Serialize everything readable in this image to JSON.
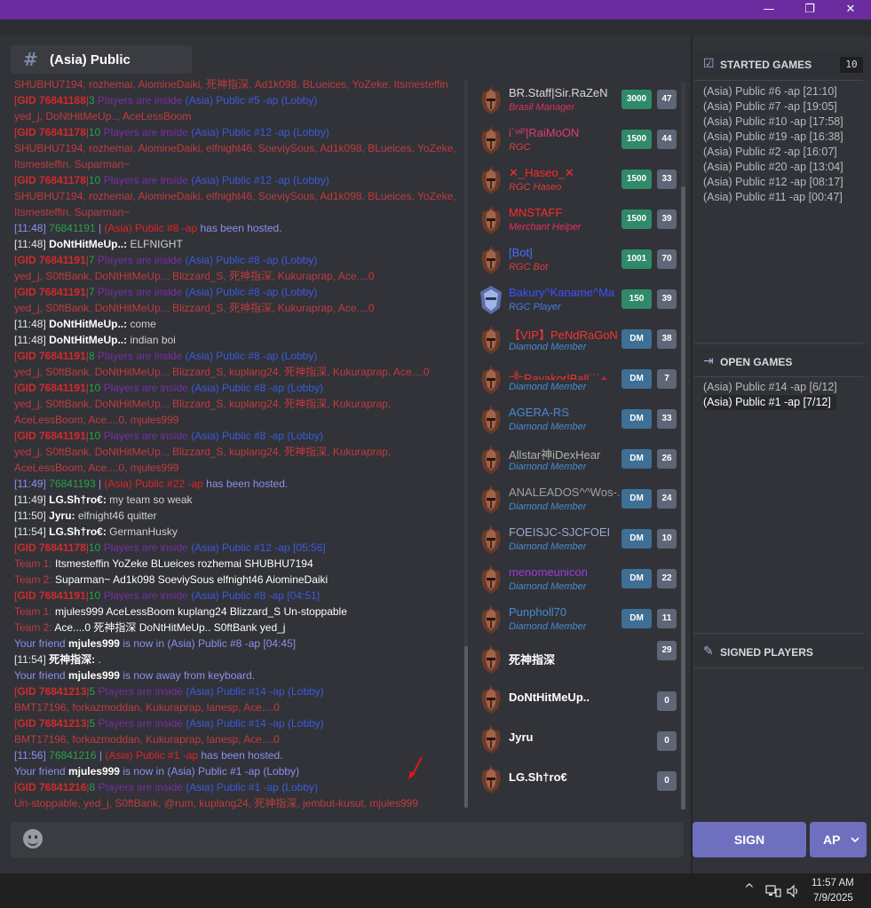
{
  "window": {
    "minimize_glyph": "—",
    "maximize_glyph": "❐",
    "close_glyph": "✕"
  },
  "channel": {
    "name": "(Asia) Public"
  },
  "chat": [
    {
      "parts": [
        {
          "t": "SHUBHU7194, rozhemai, AiomineDaiki, 死神指深, Ad1k098, BLueices, YoZeke, Itsmesteffin",
          "c": "#c23b3b"
        }
      ]
    },
    {
      "parts": [
        {
          "t": "[",
          "c": "#c23b3b"
        },
        {
          "t": "GID 76841188",
          "c": "#d22b2b",
          "b": true
        },
        {
          "t": "|",
          "c": "#c23b3b"
        },
        {
          "t": "3",
          "c": "#2aa14a"
        },
        {
          "t": " Players are inside ",
          "c": "#7a2ea3"
        },
        {
          "t": "(Asia) Public #5 -ap (Lobby)",
          "c": "#3b5bdb"
        }
      ]
    },
    {
      "parts": [
        {
          "t": "yed_j, DoNtHitMeUp.., AceLessBoom",
          "c": "#c23b3b"
        }
      ]
    },
    {
      "parts": [
        {
          "t": "[",
          "c": "#c23b3b"
        },
        {
          "t": "GID 76841178",
          "c": "#d22b2b",
          "b": true
        },
        {
          "t": "|",
          "c": "#c23b3b"
        },
        {
          "t": "10",
          "c": "#2aa14a"
        },
        {
          "t": " Players are inside ",
          "c": "#7a2ea3"
        },
        {
          "t": "(Asia) Public #12 -ap (Lobby)",
          "c": "#3b5bdb"
        }
      ]
    },
    {
      "parts": [
        {
          "t": "SHUBHU7194, rozhemai, AiomineDaiki, elfnight46, SoeviySous, Ad1k098, BLueices, YoZeke,",
          "c": "#c23b3b"
        }
      ]
    },
    {
      "parts": [
        {
          "t": "Itsmesteffin, Suparman~",
          "c": "#c23b3b"
        }
      ]
    },
    {
      "parts": [
        {
          "t": "[",
          "c": "#c23b3b"
        },
        {
          "t": "GID 76841178",
          "c": "#d22b2b",
          "b": true
        },
        {
          "t": "|",
          "c": "#c23b3b"
        },
        {
          "t": "10",
          "c": "#2aa14a"
        },
        {
          "t": " Players are inside ",
          "c": "#7a2ea3"
        },
        {
          "t": "(Asia) Public #12 -ap (Lobby)",
          "c": "#3b5bdb"
        }
      ]
    },
    {
      "parts": [
        {
          "t": "SHUBHU7194, rozhemai, AiomineDaiki, elfnight46, SoeviySous, Ad1k098, BLueices, YoZeke,",
          "c": "#c23b3b"
        }
      ]
    },
    {
      "parts": [
        {
          "t": "Itsmesteffin, Suparman~",
          "c": "#c23b3b"
        }
      ]
    },
    {
      "parts": [
        {
          "t": "[11:48] ",
          "c": "#8c8ff0"
        },
        {
          "t": "76841191",
          "c": "#2aa14a"
        },
        {
          "t": " | ",
          "c": "#8c8ff0"
        },
        {
          "t": "(Asia) Public #8 -ap",
          "c": "#e02424"
        },
        {
          "t": " has been hosted.",
          "c": "#8c8ff0"
        }
      ]
    },
    {
      "parts": [
        {
          "t": "[11:48] ",
          "c": "#e6e6e6"
        },
        {
          "t": "DoNtHitMeUp..: ",
          "c": "#ffffff",
          "b": true
        },
        {
          "t": "ELFNIGHT",
          "c": "#d0d0d0"
        }
      ]
    },
    {
      "parts": [
        {
          "t": "[",
          "c": "#c23b3b"
        },
        {
          "t": "GID 76841191",
          "c": "#d22b2b",
          "b": true
        },
        {
          "t": "|",
          "c": "#c23b3b"
        },
        {
          "t": "7",
          "c": "#2aa14a"
        },
        {
          "t": " Players are inside ",
          "c": "#7a2ea3"
        },
        {
          "t": "(Asia) Public #8 -ap (Lobby)",
          "c": "#3b5bdb"
        }
      ]
    },
    {
      "parts": [
        {
          "t": "yed_j, S0ftBank, DoNtHitMeUp.., Blizzard_S, 死神指深, Kukuraprap, Ace....0",
          "c": "#c23b3b"
        }
      ]
    },
    {
      "parts": [
        {
          "t": "[",
          "c": "#c23b3b"
        },
        {
          "t": "GID 76841191",
          "c": "#d22b2b",
          "b": true
        },
        {
          "t": "|",
          "c": "#c23b3b"
        },
        {
          "t": "7",
          "c": "#2aa14a"
        },
        {
          "t": " Players are inside ",
          "c": "#7a2ea3"
        },
        {
          "t": "(Asia) Public #8 -ap (Lobby)",
          "c": "#3b5bdb"
        }
      ]
    },
    {
      "parts": [
        {
          "t": "yed_j, S0ftBank, DoNtHitMeUp.., Blizzard_S, 死神指深, Kukuraprap, Ace....0",
          "c": "#c23b3b"
        }
      ]
    },
    {
      "parts": [
        {
          "t": "[11:48] ",
          "c": "#e6e6e6"
        },
        {
          "t": "DoNtHitMeUp..: ",
          "c": "#ffffff",
          "b": true
        },
        {
          "t": "come",
          "c": "#d0d0d0"
        }
      ]
    },
    {
      "parts": [
        {
          "t": "[11:48] ",
          "c": "#e6e6e6"
        },
        {
          "t": "DoNtHitMeUp..: ",
          "c": "#ffffff",
          "b": true
        },
        {
          "t": "indian boi",
          "c": "#d0d0d0"
        }
      ]
    },
    {
      "parts": [
        {
          "t": "[",
          "c": "#c23b3b"
        },
        {
          "t": "GID 76841191",
          "c": "#d22b2b",
          "b": true
        },
        {
          "t": "|",
          "c": "#c23b3b"
        },
        {
          "t": "8",
          "c": "#2aa14a"
        },
        {
          "t": " Players are inside ",
          "c": "#7a2ea3"
        },
        {
          "t": "(Asia) Public #8 -ap (Lobby)",
          "c": "#3b5bdb"
        }
      ]
    },
    {
      "parts": [
        {
          "t": "yed_j, S0ftBank, DoNtHitMeUp.., Blizzard_S, kuplang24, 死神指深, Kukuraprap, Ace....0",
          "c": "#c23b3b"
        }
      ]
    },
    {
      "parts": [
        {
          "t": "[",
          "c": "#c23b3b"
        },
        {
          "t": "GID 76841191",
          "c": "#d22b2b",
          "b": true
        },
        {
          "t": "|",
          "c": "#c23b3b"
        },
        {
          "t": "10",
          "c": "#2aa14a"
        },
        {
          "t": " Players are inside ",
          "c": "#7a2ea3"
        },
        {
          "t": "(Asia) Public #8 -ap (Lobby)",
          "c": "#3b5bdb"
        }
      ]
    },
    {
      "parts": [
        {
          "t": "yed_j, S0ftBank, DoNtHitMeUp.., Blizzard_S, kuplang24, 死神指深, Kukuraprap,",
          "c": "#c23b3b"
        }
      ]
    },
    {
      "parts": [
        {
          "t": "AceLessBoom, Ace....0, mjules999",
          "c": "#c23b3b"
        }
      ]
    },
    {
      "parts": [
        {
          "t": "[",
          "c": "#c23b3b"
        },
        {
          "t": "GID 76841191",
          "c": "#d22b2b",
          "b": true
        },
        {
          "t": "|",
          "c": "#c23b3b"
        },
        {
          "t": "10",
          "c": "#2aa14a"
        },
        {
          "t": " Players are inside ",
          "c": "#7a2ea3"
        },
        {
          "t": "(Asia) Public #8 -ap (Lobby)",
          "c": "#3b5bdb"
        }
      ]
    },
    {
      "parts": [
        {
          "t": "yed_j, S0ftBank, DoNtHitMeUp.., Blizzard_S, kuplang24, 死神指深, Kukuraprap,",
          "c": "#c23b3b"
        }
      ]
    },
    {
      "parts": [
        {
          "t": "AceLessBoom, Ace....0, mjules999",
          "c": "#c23b3b"
        }
      ]
    },
    {
      "parts": [
        {
          "t": "[11:49] ",
          "c": "#8c8ff0"
        },
        {
          "t": "76841193",
          "c": "#2aa14a"
        },
        {
          "t": " | ",
          "c": "#8c8ff0"
        },
        {
          "t": "(Asia) Public #22 -ap",
          "c": "#e02424"
        },
        {
          "t": " has been hosted.",
          "c": "#8c8ff0"
        }
      ]
    },
    {
      "parts": [
        {
          "t": "[11:49] ",
          "c": "#e6e6e6"
        },
        {
          "t": "LG.Sh†ro€: ",
          "c": "#ffffff",
          "b": true
        },
        {
          "t": "my team so weak",
          "c": "#d0d0d0"
        }
      ]
    },
    {
      "parts": [
        {
          "t": "[11:50] ",
          "c": "#e6e6e6"
        },
        {
          "t": "Jyru: ",
          "c": "#ffffff",
          "b": true
        },
        {
          "t": "elfnight46 quitter",
          "c": "#d0d0d0"
        }
      ]
    },
    {
      "parts": [
        {
          "t": "[11:54] ",
          "c": "#e6e6e6"
        },
        {
          "t": "LG.Sh†ro€: ",
          "c": "#ffffff",
          "b": true
        },
        {
          "t": "GermanHusky",
          "c": "#d0d0d0"
        }
      ]
    },
    {
      "parts": [
        {
          "t": "[",
          "c": "#c23b3b"
        },
        {
          "t": "GID 76841178",
          "c": "#d22b2b",
          "b": true
        },
        {
          "t": "|",
          "c": "#c23b3b"
        },
        {
          "t": "10",
          "c": "#2aa14a"
        },
        {
          "t": " Players are inside ",
          "c": "#7a2ea3"
        },
        {
          "t": "(Asia) Public #12 -ap [05:56]",
          "c": "#3b5bdb"
        }
      ]
    },
    {
      "parts": [
        {
          "t": "Team 1:   ",
          "c": "#c23b3b"
        },
        {
          "t": "Itsmesteffin    YoZeke    BLueices    rozhemai    SHUBHU7194",
          "c": "#ffffff"
        }
      ]
    },
    {
      "parts": [
        {
          "t": "Team 2:   ",
          "c": "#c23b3b"
        },
        {
          "t": "Suparman~    Ad1k098    SoeviySous    elfnight46    AiomineDaiki",
          "c": "#ffffff"
        }
      ]
    },
    {
      "parts": [
        {
          "t": "[",
          "c": "#c23b3b"
        },
        {
          "t": "GID 76841191",
          "c": "#d22b2b",
          "b": true
        },
        {
          "t": "|",
          "c": "#c23b3b"
        },
        {
          "t": "10",
          "c": "#2aa14a"
        },
        {
          "t": " Players are inside ",
          "c": "#7a2ea3"
        },
        {
          "t": "(Asia) Public #8 -ap [04:51]",
          "c": "#3b5bdb"
        }
      ]
    },
    {
      "parts": [
        {
          "t": "Team 1:   ",
          "c": "#c23b3b"
        },
        {
          "t": "mjules999    AceLessBoom    kuplang24    Blizzard_S    Un-stoppable",
          "c": "#ffffff"
        }
      ]
    },
    {
      "parts": [
        {
          "t": "Team 2:   ",
          "c": "#c23b3b"
        },
        {
          "t": "Ace....0    死神指深    DoNtHitMeUp..    S0ftBank    yed_j",
          "c": "#ffffff"
        }
      ]
    },
    {
      "parts": [
        {
          "t": "Your friend ",
          "c": "#8c8ff0"
        },
        {
          "t": "mjules999",
          "c": "#ffffff",
          "b": true
        },
        {
          "t": " is now in (Asia) Public #8 -ap [04:45]",
          "c": "#8c8ff0"
        }
      ]
    },
    {
      "parts": [
        {
          "t": "[11:54] ",
          "c": "#e6e6e6"
        },
        {
          "t": "死神指深: ",
          "c": "#ffffff",
          "b": true
        },
        {
          "t": ".",
          "c": "#d0d0d0"
        }
      ]
    },
    {
      "parts": [
        {
          "t": "Your friend ",
          "c": "#8c8ff0"
        },
        {
          "t": "mjules999",
          "c": "#ffffff",
          "b": true
        },
        {
          "t": " is now away from keyboard.",
          "c": "#8c8ff0"
        }
      ]
    },
    {
      "parts": [
        {
          "t": "[",
          "c": "#c23b3b"
        },
        {
          "t": "GID 76841213",
          "c": "#d22b2b",
          "b": true
        },
        {
          "t": "|",
          "c": "#c23b3b"
        },
        {
          "t": "5",
          "c": "#2aa14a"
        },
        {
          "t": " Players are inside ",
          "c": "#7a2ea3"
        },
        {
          "t": "(Asia) Public #14 -ap (Lobby)",
          "c": "#3b5bdb"
        }
      ]
    },
    {
      "parts": [
        {
          "t": "BMT17196, forkazmoddan, Kukuraprap, lanesp, Ace....0",
          "c": "#c23b3b"
        }
      ]
    },
    {
      "parts": [
        {
          "t": "[",
          "c": "#c23b3b"
        },
        {
          "t": "GID 76841213",
          "c": "#d22b2b",
          "b": true
        },
        {
          "t": "|",
          "c": "#c23b3b"
        },
        {
          "t": "5",
          "c": "#2aa14a"
        },
        {
          "t": " Players are inside ",
          "c": "#7a2ea3"
        },
        {
          "t": "(Asia) Public #14 -ap (Lobby)",
          "c": "#3b5bdb"
        }
      ]
    },
    {
      "parts": [
        {
          "t": "BMT17196, forkazmoddan, Kukuraprap, lanesp, Ace....0",
          "c": "#c23b3b"
        }
      ]
    },
    {
      "parts": [
        {
          "t": "[11:56] ",
          "c": "#8c8ff0"
        },
        {
          "t": "76841216",
          "c": "#2aa14a"
        },
        {
          "t": " | ",
          "c": "#8c8ff0"
        },
        {
          "t": "(Asia) Public #1 -ap",
          "c": "#e02424"
        },
        {
          "t": " has been hosted.",
          "c": "#8c8ff0"
        }
      ]
    },
    {
      "parts": [
        {
          "t": "Your friend ",
          "c": "#8c8ff0"
        },
        {
          "t": "mjules999",
          "c": "#ffffff",
          "b": true
        },
        {
          "t": " is now in (Asia) Public #1 -ap (Lobby)",
          "c": "#8c8ff0"
        }
      ]
    },
    {
      "parts": [
        {
          "t": "[",
          "c": "#c23b3b"
        },
        {
          "t": "GID 76841216",
          "c": "#d22b2b",
          "b": true
        },
        {
          "t": "|",
          "c": "#c23b3b"
        },
        {
          "t": "8",
          "c": "#2aa14a"
        },
        {
          "t": " Players are inside ",
          "c": "#7a2ea3"
        },
        {
          "t": "(Asia) Public #1 -ap (Lobby)",
          "c": "#3b5bdb"
        }
      ]
    },
    {
      "parts": [
        {
          "t": "Un-stoppable, yed_j, S0ftBank, @rum, kuplang24, 死神指深, jembut-kusut, mjules999",
          "c": "#c23b3b"
        }
      ]
    }
  ],
  "players": [
    {
      "name": "BR.Staff|Sir.RaZeN",
      "name_color": "#d8d8d8",
      "role": "Brasil Manager",
      "role_color": "#e0305a",
      "rank": "3000",
      "rank_color": "#2f8a6a",
      "count": "47",
      "avatar": "warrior"
    },
    {
      "name": "i´ᵛᶦᴾ|RaiMoON",
      "name_color": "#e03b6a",
      "role": "RGC",
      "role_color": "#e03b3b",
      "rank": "1500",
      "rank_color": "#2f8a6a",
      "count": "44",
      "avatar": "warrior"
    },
    {
      "name": "✕_Haseo_✕",
      "name_color": "#ff2a2a",
      "role": "RGC Haseo",
      "role_color": "#e03b3b",
      "rank": "1500",
      "rank_color": "#2f8a6a",
      "count": "33",
      "avatar": "warrior"
    },
    {
      "name": "MNSTAFF",
      "name_color": "#ff2a2a",
      "role": "Merchant Helper",
      "role_color": "#e0305a",
      "rank": "1500",
      "rank_color": "#2f8a6a",
      "count": "39",
      "avatar": "warrior"
    },
    {
      "name": "[Bot]",
      "name_color": "#4a6cff",
      "role": "RGC Bot",
      "role_color": "#e03b3b",
      "rank": "1001",
      "rank_color": "#2f8a6a",
      "count": "70",
      "avatar": "warrior"
    },
    {
      "name": "Bakury^Kaname^Ma",
      "name_color": "#3b50ff",
      "role": "RGC Player",
      "role_color": "#4a7ae0",
      "rank": "150",
      "rank_color": "#2f8a6a",
      "count": "39",
      "avatar": "knight"
    },
    {
      "name": "【VIP】PeNdRaGoN",
      "name_color": "#ff3030",
      "role": "Diamond Member",
      "role_color": "#4a88d0",
      "rank": "DM",
      "rank_color": "#3f6f95",
      "count": "38",
      "avatar": "warrior"
    },
    {
      "name": "༒Ravakor|Ball˙˙˙+",
      "name_color": "#ff3030",
      "role": "Diamond Member",
      "role_color": "#4a88d0",
      "rank": "DM",
      "rank_color": "#3f6f95",
      "count": "7",
      "avatar": "warrior"
    },
    {
      "name": "AGERA-RS",
      "name_color": "#4a88d0",
      "role": "Diamond Member",
      "role_color": "#4a88d0",
      "rank": "DM",
      "rank_color": "#3f6f95",
      "count": "33",
      "avatar": "warrior"
    },
    {
      "name": "Allstar神iDexHear",
      "name_color": "#b0b0b0",
      "role": "Diamond Member",
      "role_color": "#4a88d0",
      "rank": "DM",
      "rank_color": "#3f6f95",
      "count": "26",
      "avatar": "warrior"
    },
    {
      "name": "ANALEADOS^^Wos-.-",
      "name_color": "#a0a0a0",
      "role": "Diamond Member",
      "role_color": "#4a88d0",
      "rank": "DM",
      "rank_color": "#3f6f95",
      "count": "24",
      "avatar": "warrior"
    },
    {
      "name": "FOEISJC-SJCFOEI",
      "name_color": "#9aa8c8",
      "role": "Diamond Member",
      "role_color": "#4a88d0",
      "rank": "DM",
      "rank_color": "#3f6f95",
      "count": "10",
      "avatar": "warrior"
    },
    {
      "name": "menomeunicon",
      "name_color": "#9a3bd8",
      "role": "Diamond Member",
      "role_color": "#4a88d0",
      "rank": "DM",
      "rank_color": "#3f6f95",
      "count": "22",
      "avatar": "warrior"
    },
    {
      "name": "Punpholl70",
      "name_color": "#4a88d0",
      "role": "Diamond Member",
      "role_color": "#4a88d0",
      "rank": "DM",
      "rank_color": "#3f6f95",
      "count": "11",
      "avatar": "warrior"
    },
    {
      "name": "死神指深",
      "name_color": "#ffffff",
      "role": "",
      "role_color": "#4a88d0",
      "rank": "",
      "rank_color": "",
      "count": "29",
      "avatar": "warrior"
    },
    {
      "name": "DoNtHitMeUp..",
      "name_color": "#ffffff",
      "role": "",
      "role_color": "#4a88d0",
      "rank": "",
      "rank_color": "",
      "count": "0",
      "avatar": "warrior"
    },
    {
      "name": "Jyru",
      "name_color": "#ffffff",
      "role": "",
      "role_color": "#4a88d0",
      "rank": "",
      "rank_color": "",
      "count": "0",
      "avatar": "warrior"
    },
    {
      "name": "LG.Sh†ro€",
      "name_color": "#ffffff",
      "role": "",
      "role_color": "#4a88d0",
      "rank": "",
      "rank_color": "",
      "count": "0",
      "avatar": "warrior"
    }
  ],
  "started_games": {
    "title": "STARTED GAMES",
    "badge": "10",
    "items": [
      "(Asia) Public #6 -ap [21:10]",
      "(Asia) Public #7 -ap [19:05]",
      "(Asia) Public #10 -ap [17:58]",
      "(Asia) Public #19 -ap [16:38]",
      "(Asia) Public #2 -ap [16:07]",
      "(Asia) Public #20 -ap [13:04]",
      "(Asia) Public #12 -ap [08:17]",
      "(Asia) Public #11 -ap [00:47]"
    ]
  },
  "open_games": {
    "title": "OPEN GAMES",
    "items": [
      "(Asia) Public #14 -ap [6/12]",
      "(Asia) Public #1 -ap [7/12]"
    ]
  },
  "signed_players": {
    "title": "SIGNED PLAYERS"
  },
  "input": {
    "placeholder": ""
  },
  "buttons": {
    "sign": "SIGN",
    "ap": "AP"
  },
  "taskbar": {
    "time": "11:57 AM",
    "date": "7/9/2025"
  },
  "colors": {
    "titlebar": "#6a2c9e",
    "button": "#6e6fbf",
    "background": "#313338"
  }
}
